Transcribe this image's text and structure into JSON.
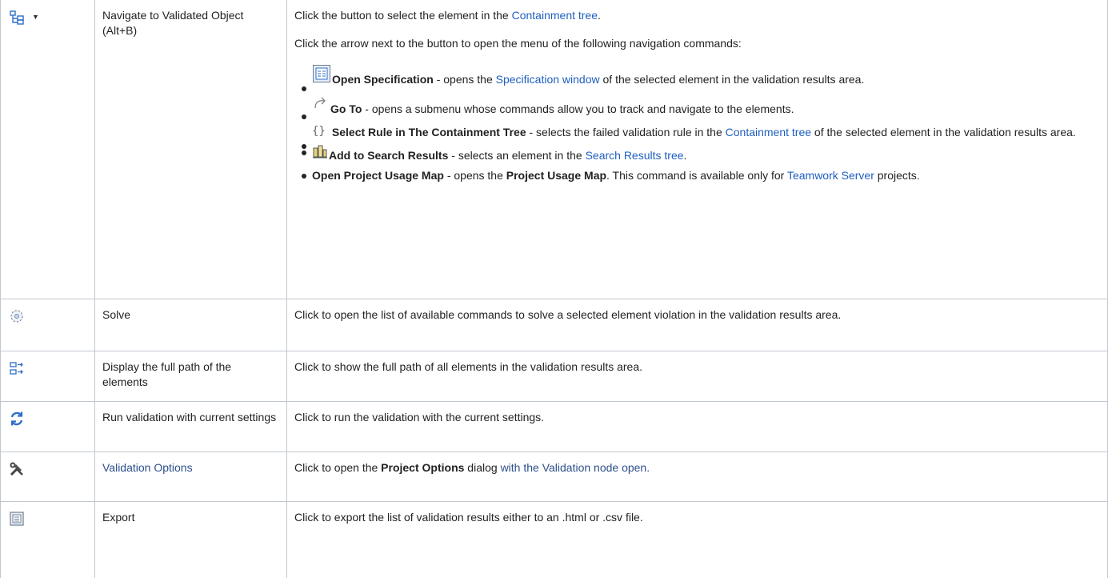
{
  "rows": [
    {
      "name": "Navigate to Validated Object (Alt+B)",
      "icon": "navigate-tree-icon",
      "desc_p1_pre": "Click the button to select the element in the ",
      "desc_p1_link": "Containment tree",
      "desc_p1_post": ".",
      "desc_p2": "Click the arrow next to the button to open the menu of the following navigation commands:",
      "items": [
        {
          "icon": "specification-icon",
          "bold": "Open Specification",
          "pre": " - opens the ",
          "link": "Specification window",
          "post": " of the selected element in the validation results area."
        },
        {
          "icon": "go-to-icon",
          "bold": "Go To",
          "pre": " - opens a submenu whose commands allow you to track and navigate to the elements.",
          "link": "",
          "post": ""
        },
        {
          "icon": "braces-icon",
          "bold": "Select Rule in The Containment Tree",
          "pre": " - selects the failed validation rule in the ",
          "link": "Containment tree",
          "post": " of the selected element in the validation results area."
        },
        {
          "icon": "search-results-icon",
          "bold": "Add to Search Results",
          "pre": " - selects an element in the ",
          "link": "Search Results tree",
          "post": "."
        },
        {
          "icon": "",
          "bold": "Open Project Usage Map",
          "pre": " - opens the ",
          "bold2": "Project Usage Map",
          "pre2": ". This command is available only for ",
          "link": "Teamwork Server",
          "post": " projects."
        }
      ]
    },
    {
      "name": "Solve",
      "icon": "solve-icon",
      "desc": "Click to open the list of available commands to solve a selected element violation in the validation results area."
    },
    {
      "name": "Display the full path of the elements",
      "icon": "full-path-icon",
      "desc": "Click to show the full path of all elements in the validation results area."
    },
    {
      "name": "Run validation with current settings",
      "icon": "refresh-icon",
      "desc": "Click to run the validation with the current settings."
    },
    {
      "name": "Validation Options",
      "icon": "tools-icon",
      "desc_pre": "Click to open the ",
      "desc_bold": "Project Options",
      "desc_mid": " dialog ",
      "desc_link": "with the Validation node open."
    },
    {
      "name": "Export",
      "icon": "export-icon",
      "desc": "Click to export the list of validation results either to an .html or .csv file."
    }
  ],
  "colors": {
    "link": "#1f5fbf",
    "border": "#c1c7d0",
    "icon_blue": "#2f6fc8"
  }
}
